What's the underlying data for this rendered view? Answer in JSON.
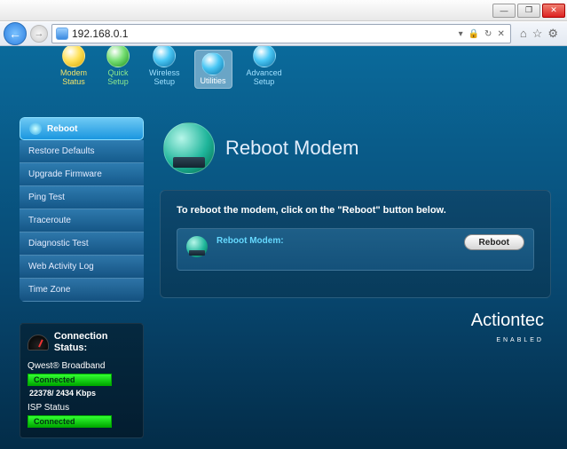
{
  "browser": {
    "url": "192.168.0.1"
  },
  "topnav": {
    "modem": {
      "l1": "Modem",
      "l2": "Status"
    },
    "quick": {
      "l1": "Quick",
      "l2": "Setup"
    },
    "wireless": {
      "l1": "Wireless",
      "l2": "Setup"
    },
    "util": {
      "l1": "Utilities",
      "l2": ""
    },
    "adv": {
      "l1": "Advanced",
      "l2": "Setup"
    }
  },
  "sidebar": {
    "items": [
      {
        "label": "Reboot"
      },
      {
        "label": "Restore Defaults"
      },
      {
        "label": "Upgrade Firmware"
      },
      {
        "label": "Ping Test"
      },
      {
        "label": "Traceroute"
      },
      {
        "label": "Diagnostic Test"
      },
      {
        "label": "Web Activity Log"
      },
      {
        "label": "Time Zone"
      }
    ]
  },
  "conn": {
    "title": "Connection Status:",
    "bb_label": "Qwest® Broadband",
    "bb_status": "Connected",
    "speed": "22378/ 2434 Kbps",
    "isp_label": "ISP Status",
    "isp_status": "Connected"
  },
  "main": {
    "title": "Reboot Modem",
    "instruction": "To reboot the modem, click on the \"Reboot\" button below.",
    "inner_label": "Reboot Modem:",
    "button": "Reboot"
  },
  "brand": {
    "name": "Actiontec",
    "sub": "ENABLED"
  }
}
